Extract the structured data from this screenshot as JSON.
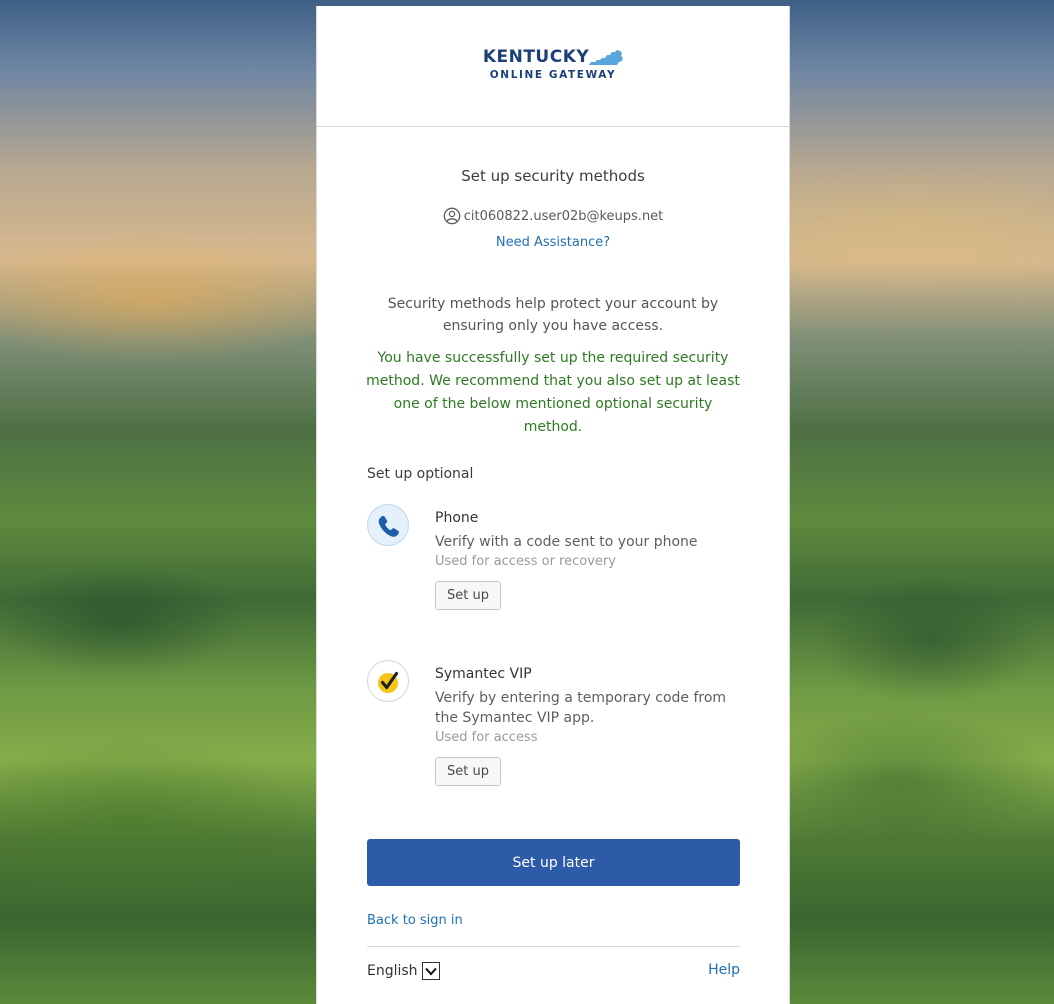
{
  "header": {
    "logo_word": "KENTUCKY",
    "logo_sub": "ONLINE GATEWAY"
  },
  "title": "Set up security methods",
  "identity": {
    "email": "cit060822.user02b@keups.net"
  },
  "assistance_link": "Need Assistance?",
  "description": "Security methods help protect your account by ensuring only you have access.",
  "success_message": "You have successfully set up the required security method. We recommend that you also set up at least one of the below mentioned optional security method.",
  "optional_heading": "Set up optional",
  "methods": [
    {
      "name": "Phone",
      "description": "Verify with a code sent to your phone",
      "usage": "Used for access or recovery",
      "button_label": "Set up",
      "icon": "phone-icon"
    },
    {
      "name": "Symantec VIP",
      "description": "Verify by entering a temporary code from the Symantec VIP app.",
      "usage": "Used for access",
      "button_label": "Set up",
      "icon": "symantec-checkmark-icon"
    }
  ],
  "later_button": "Set up later",
  "back_link": "Back to sign in",
  "footer": {
    "language": "English",
    "help": "Help"
  },
  "colors": {
    "primary_button": "#2d5ba7",
    "link": "#1f6fb5",
    "success_text": "#2e7a22",
    "logo_navy": "#1d3f78",
    "logo_state_blue": "#5aa5dc",
    "symantec_yellow": "#f5c518"
  }
}
